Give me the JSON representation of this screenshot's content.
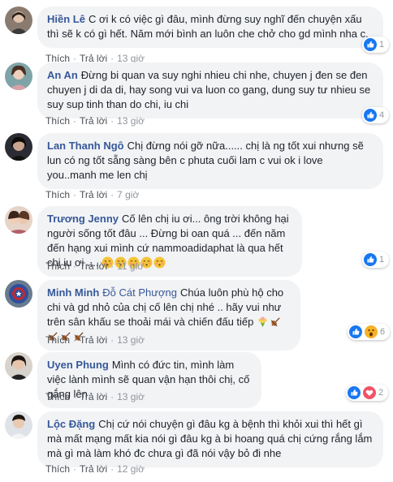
{
  "colors": {
    "link": "#365899",
    "bubble": "#f2f3f5",
    "meta": "#90949c",
    "like_blue": "#1877f2",
    "love_red": "#f25268",
    "wow_yellow": "#f7b125"
  },
  "comments": [
    {
      "name": "Hiền Lê",
      "text": "C ơi k có việc gì đâu, mình đừng suy nghĩ đến chuyện xấu thì sẽ k có gì hết. Năm mới bình an luôn che chở cho gd mình nha c.",
      "like": "Thích",
      "reply": "Trả lời",
      "time": "13 giờ",
      "reactions": {
        "icons": [
          "like-icon"
        ],
        "count": "1"
      }
    },
    {
      "name": "An An",
      "text": "Đừng bi quan va suy nghi nhieu chi nhe, chuyen j đen se đen chuyen j di da di, hay song vui va luon co gang, dung suy tư nhieu se suy sup tinh than do chi, iu chi",
      "like": "Thích",
      "reply": "Trả lời",
      "time": "13 giờ",
      "reactions": {
        "icons": [
          "like-icon"
        ],
        "count": "4"
      }
    },
    {
      "name": "Lan Thanh Ngô",
      "text": "Chị đừng nói gỡ nữa...... chị là ng tốt xui nhưng sẽ lun có ng tốt sẵng sàng bên c phuta cuối lam c vui ok i love you..manh me len chị",
      "like": "Thích",
      "reply": "Trả lời",
      "time": "7 giờ",
      "reactions": null
    },
    {
      "name": "Trương Jenny",
      "text": "Cố lên chị iu ơi... ông trời không hại người sống tốt đâu ... Đừng bi oan quá ... đến năm đến hạng xui mình cứ nammoadidaphat là qua hết chị iu ơi ....",
      "emojis": [
        "kiss-emoji",
        "kiss-emoji",
        "kiss-emoji",
        "kiss-emoji",
        "kiss-emoji"
      ],
      "like": "Thích",
      "reply": "Trả lời",
      "time": "11 giờ",
      "reactions": {
        "icons": [
          "like-icon"
        ],
        "count": "1"
      }
    },
    {
      "name": "Minh Minh",
      "tag": "Đỗ Cát Phượng",
      "text": "Chúa luôn phù hộ cho chi và gd nhỏ của chị cố lên chị nhé .. hãy vui như trên sân khấu se thoải mái và chiến đấu tiếp",
      "emojis": [
        "bouquet-emoji",
        "violin-emoji",
        "violin-emoji",
        "violin-emoji",
        "violin-emoji"
      ],
      "like": "Thích",
      "reply": "Trả lời",
      "time": "13 giờ",
      "reactions": {
        "icons": [
          "like-icon",
          "wow-icon"
        ],
        "count": "6"
      }
    },
    {
      "name": "Uyen Phung",
      "text": "Mình có đức tin, mình làm việc lành mình sẽ quan vận hạn thôi chị, cố gắng lên",
      "like": "Thích",
      "reply": "Trả lời",
      "time": "13 giờ",
      "reactions": {
        "icons": [
          "like-icon",
          "love-icon"
        ],
        "count": "2"
      }
    },
    {
      "name": "Lộc Đặng",
      "text": "Chị cứ nói chuyện gì đâu kg à bệnh thì khỏi xui thì hết gì mà mất mạng mất kia nói gì đâu kg à bi hoang quá chị cứng rắng lắm mà gì mà làm khó đc chưa gì đã nói vậy bỏ đi nhe",
      "like": "Thích",
      "reply": "Trả lời",
      "time": "12 giờ",
      "reactions": null
    }
  ]
}
